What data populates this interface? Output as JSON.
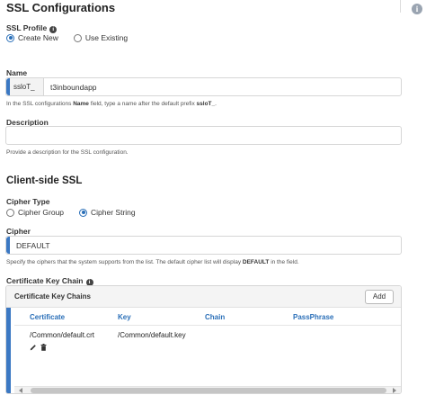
{
  "page": {
    "title": "SSL Configurations"
  },
  "ssl_profile": {
    "label": "SSL Profile",
    "options": [
      {
        "label": "Create New",
        "selected": true
      },
      {
        "label": "Use Existing",
        "selected": false
      }
    ]
  },
  "name": {
    "label": "Name",
    "prefix": "ssloT_",
    "value": "t3inboundapp",
    "help_pre": "In the SSL configurations ",
    "help_bold1": "Name",
    "help_mid": " field, type a name after the default prefix ",
    "help_bold2": "ssloT_",
    "help_post": "."
  },
  "description": {
    "label": "Description",
    "value": "",
    "help": "Provide a description for the SSL configuration."
  },
  "client_side": {
    "title": "Client-side SSL"
  },
  "cipher_type": {
    "label": "Cipher Type",
    "options": [
      {
        "label": "Cipher Group",
        "selected": false
      },
      {
        "label": "Cipher String",
        "selected": true
      }
    ]
  },
  "cipher": {
    "label": "Cipher",
    "value": "DEFAULT",
    "help_pre": "Specify the ciphers that the system supports from the list. The default cipher list will display ",
    "help_bold": "DEFAULT",
    "help_post": " in the field."
  },
  "cert_key_chain": {
    "label": "Certificate Key Chain",
    "box_title": "Certificate Key Chains",
    "add_label": "Add",
    "columns": [
      "Certificate",
      "Key",
      "Chain",
      "PassPhrase"
    ],
    "rows": [
      {
        "certificate": "/Common/default.crt",
        "key": "/Common/default.key",
        "chain": "",
        "passphrase": ""
      }
    ]
  },
  "icons": {
    "info": "info-icon",
    "edit": "pencil-icon",
    "delete": "trash-icon"
  },
  "colors": {
    "accent": "#2a6fb8",
    "required_bar": "#3b78c3"
  }
}
